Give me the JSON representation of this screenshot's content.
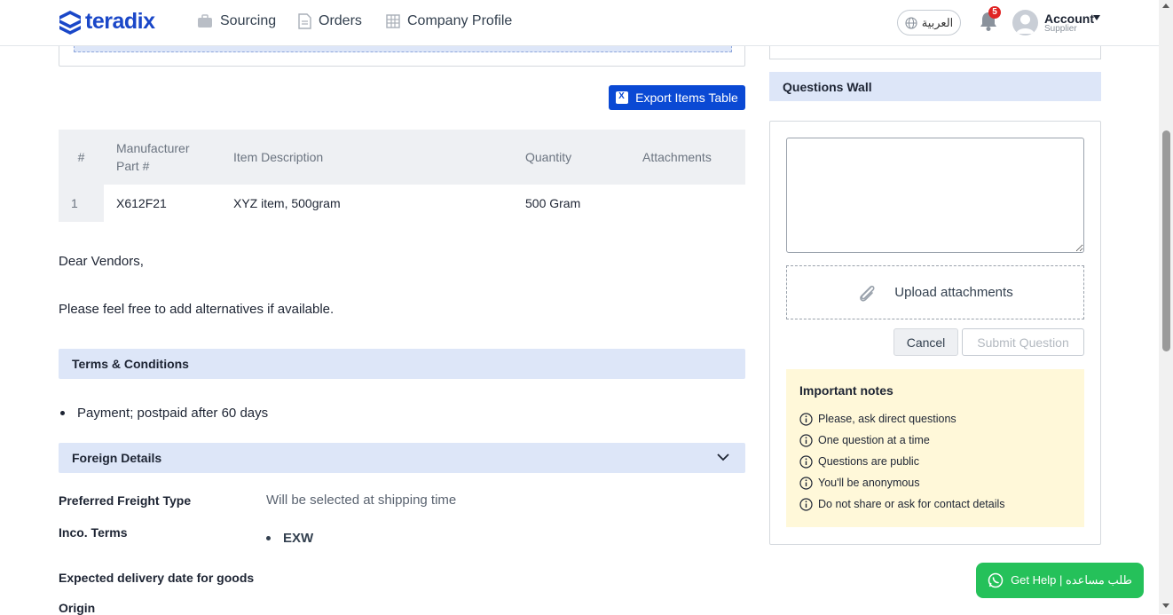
{
  "brand": {
    "name": "teradix",
    "color": "#1a47c8"
  },
  "nav": {
    "items": [
      {
        "label": "Sourcing",
        "icon": "briefcase-icon"
      },
      {
        "label": "Orders",
        "icon": "document-icon"
      },
      {
        "label": "Company Profile",
        "icon": "building-icon"
      }
    ],
    "language": "العربية",
    "notifications_count": "5",
    "account_name": "Account",
    "account_role": "Supplier"
  },
  "items_table": {
    "export_label": "Export Items Table",
    "headers": [
      "#",
      "Manufacturer Part #",
      "Item Description",
      "Quantity",
      "Attachments"
    ],
    "rows": [
      {
        "index": "1",
        "part": "X612F21",
        "description": "XYZ item, 500gram",
        "quantity": "500 Gram",
        "attachments": ""
      }
    ]
  },
  "message": {
    "greeting": "Dear Vendors,",
    "body": "Please feel free to add alternatives if available."
  },
  "terms": {
    "title": "Terms & Conditions",
    "items": [
      "Payment; postpaid after 60 days"
    ]
  },
  "foreign": {
    "title": "Foreign Details",
    "freight_label": "Preferred Freight Type",
    "freight_value": "Will be selected at shipping time",
    "inco_label": "Inco. Terms",
    "inco_value": "EXW",
    "delivery_label": "Expected delivery date for goods",
    "origin_label": "Origin"
  },
  "questions": {
    "title": "Questions Wall",
    "question_value": "",
    "upload_label": "Upload attachments",
    "cancel_label": "Cancel",
    "submit_label": "Submit Question",
    "notes_title": "Important notes",
    "notes": [
      "Please, ask direct questions",
      "One question at a time",
      "Questions are public",
      "You'll be anonymous",
      "Do not share or ask for contact details"
    ]
  },
  "help": {
    "label": "Get Help | طلب مساعده",
    "icon": "whatsapp-icon"
  },
  "colors": {
    "primary": "#0a49d4",
    "section_bg": "#dde6f8",
    "notes_bg": "#fff8d9",
    "help_green": "#25c15a",
    "badge_red": "#e02424"
  }
}
